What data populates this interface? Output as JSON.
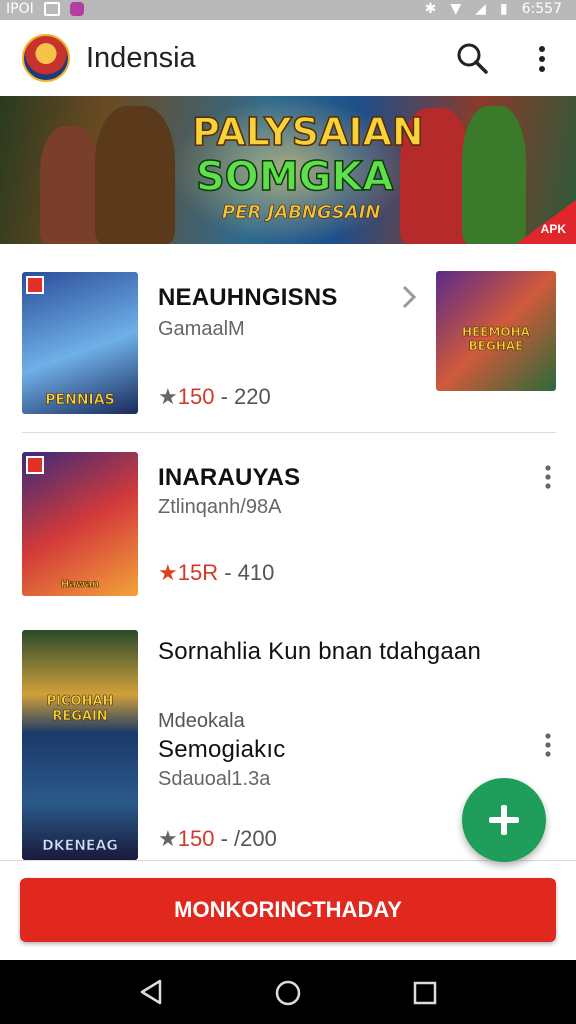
{
  "status_bar": {
    "left_text": "IPOI",
    "right_time": "6:557"
  },
  "app_bar": {
    "title": "Indensia"
  },
  "banner": {
    "line1": "PALYSAIAN",
    "line2": "SOMGKA",
    "line3": "PER JABNGSAIN",
    "tag": "APK"
  },
  "items": [
    {
      "thumb_caption": "PENNIAS",
      "title": "NEAUHNGISNS",
      "subtitle": "GamaalM",
      "rating": "150",
      "rating_sep": "-",
      "count": "220",
      "side_thumb_caption": "HEEMOHA BEGHAE"
    },
    {
      "thumb_caption": "Hawan",
      "title": "INARAUYAS",
      "subtitle": "Ztlinqanh/98A",
      "rating": "15R",
      "rating_sep": "-",
      "count": "410"
    },
    {
      "thumb_caption_top": "PICOHAH REGAIN",
      "thumb_caption": "DKENEAG",
      "title": "Sornahlia Kun bnan tdahgaan",
      "subtitle1": "Mdeokala",
      "title2": "Semogiakıc",
      "subtitle2": "Sdauoal1.3a",
      "rating": "150",
      "rating_sep": "-",
      "count": "/200"
    }
  ],
  "cta": {
    "label": "MONKORINCTHADAY"
  },
  "colors": {
    "brand_red": "#e0281f",
    "fab_green": "#1f9d5a",
    "rating_red": "#d03a2a"
  }
}
